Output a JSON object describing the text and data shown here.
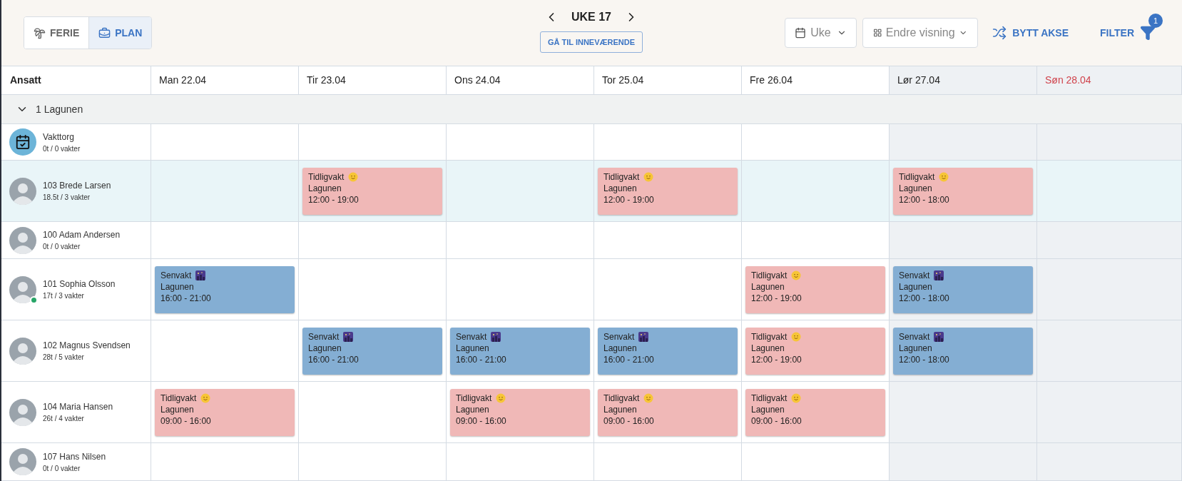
{
  "mode_tabs": [
    {
      "label": "FERIE",
      "selected": false
    },
    {
      "label": "PLAN",
      "selected": true
    }
  ],
  "week": {
    "title": "UKE 17",
    "today_button": "GÅ TIL INNEVÆRENDE"
  },
  "view_select": {
    "value": "Uke"
  },
  "display_select": {
    "value": "Endre visning"
  },
  "swap_button": "BYTT AKSE",
  "filter": {
    "label": "FILTER",
    "badge": "1"
  },
  "columns": {
    "first": "Ansatt",
    "days": [
      {
        "label": "Man 22.04",
        "weekend": false,
        "holiday": false
      },
      {
        "label": "Tir 23.04",
        "weekend": false,
        "holiday": false
      },
      {
        "label": "Ons 24.04",
        "weekend": false,
        "holiday": false
      },
      {
        "label": "Tor 25.04",
        "weekend": false,
        "holiday": false
      },
      {
        "label": "Fre 26.04",
        "weekend": false,
        "holiday": false
      },
      {
        "label": "Lør 27.04",
        "weekend": true,
        "holiday": false
      },
      {
        "label": "Søn 28.04",
        "weekend": true,
        "holiday": true
      }
    ]
  },
  "group": {
    "name": "1 Lagunen",
    "expanded": true
  },
  "employees": [
    {
      "name": "Vakttorg",
      "hours": "0t / 0 vakter",
      "kind": "pool",
      "online": false,
      "selected": false,
      "cells": [
        {
          "kind": "none"
        },
        {
          "kind": "none"
        },
        {
          "kind": "none"
        },
        {
          "kind": "none"
        },
        {
          "kind": "none"
        },
        {
          "kind": "none"
        },
        {
          "kind": "none"
        }
      ]
    },
    {
      "name": "103 Brede Larsen",
      "hours": "18.5t / 3 vakter",
      "kind": "person",
      "online": false,
      "selected": true,
      "cells": [
        {
          "kind": "none"
        },
        {
          "kind": "early",
          "title": "Tidligvakt",
          "place": "Lagunen",
          "time": "12:00 - 19:00"
        },
        {
          "kind": "none"
        },
        {
          "kind": "early",
          "title": "Tidligvakt",
          "place": "Lagunen",
          "time": "12:00 - 19:00"
        },
        {
          "kind": "none"
        },
        {
          "kind": "early",
          "title": "Tidligvakt",
          "place": "Lagunen",
          "time": "12:00 - 18:00"
        },
        {
          "kind": "none"
        }
      ]
    },
    {
      "name": "100 Adam Andersen",
      "hours": "0t / 0 vakter",
      "kind": "person",
      "online": false,
      "selected": false,
      "cells": [
        {
          "kind": "none"
        },
        {
          "kind": "none"
        },
        {
          "kind": "none"
        },
        {
          "kind": "none"
        },
        {
          "kind": "none"
        },
        {
          "kind": "none"
        },
        {
          "kind": "none"
        }
      ]
    },
    {
      "name": "101 Sophia Olsson",
      "hours": "17t / 3 vakter",
      "kind": "person",
      "online": true,
      "selected": false,
      "cells": [
        {
          "kind": "late",
          "title": "Senvakt",
          "place": "Lagunen",
          "time": "16:00 - 21:00"
        },
        {
          "kind": "none"
        },
        {
          "kind": "none"
        },
        {
          "kind": "none"
        },
        {
          "kind": "early",
          "title": "Tidligvakt",
          "place": "Lagunen",
          "time": "12:00 - 19:00"
        },
        {
          "kind": "late",
          "title": "Senvakt",
          "place": "Lagunen",
          "time": "12:00 - 18:00"
        },
        {
          "kind": "none"
        }
      ]
    },
    {
      "name": "102 Magnus Svendsen",
      "hours": "28t / 5 vakter",
      "kind": "person",
      "online": false,
      "selected": false,
      "cells": [
        {
          "kind": "none"
        },
        {
          "kind": "late",
          "title": "Senvakt",
          "place": "Lagunen",
          "time": "16:00 - 21:00"
        },
        {
          "kind": "late",
          "title": "Senvakt",
          "place": "Lagunen",
          "time": "16:00 - 21:00"
        },
        {
          "kind": "late",
          "title": "Senvakt",
          "place": "Lagunen",
          "time": "16:00 - 21:00"
        },
        {
          "kind": "early",
          "title": "Tidligvakt",
          "place": "Lagunen",
          "time": "12:00 - 19:00"
        },
        {
          "kind": "late",
          "title": "Senvakt",
          "place": "Lagunen",
          "time": "12:00 - 18:00"
        },
        {
          "kind": "none"
        }
      ]
    },
    {
      "name": "104 Maria Hansen",
      "hours": "26t / 4 vakter",
      "kind": "person",
      "online": false,
      "selected": false,
      "cells": [
        {
          "kind": "early",
          "title": "Tidligvakt",
          "place": "Lagunen",
          "time": "09:00 - 16:00"
        },
        {
          "kind": "none"
        },
        {
          "kind": "early",
          "title": "Tidligvakt",
          "place": "Lagunen",
          "time": "09:00 - 16:00"
        },
        {
          "kind": "early",
          "title": "Tidligvakt",
          "place": "Lagunen",
          "time": "09:00 - 16:00"
        },
        {
          "kind": "early",
          "title": "Tidligvakt",
          "place": "Lagunen",
          "time": "09:00 - 16:00"
        },
        {
          "kind": "none"
        },
        {
          "kind": "none"
        }
      ]
    },
    {
      "name": "107 Hans Nilsen",
      "hours": "0t / 0 vakter",
      "kind": "person",
      "online": false,
      "selected": false,
      "cells": [
        {
          "kind": "none"
        },
        {
          "kind": "none"
        },
        {
          "kind": "none"
        },
        {
          "kind": "none"
        },
        {
          "kind": "none"
        },
        {
          "kind": "none"
        },
        {
          "kind": "none"
        }
      ]
    }
  ]
}
